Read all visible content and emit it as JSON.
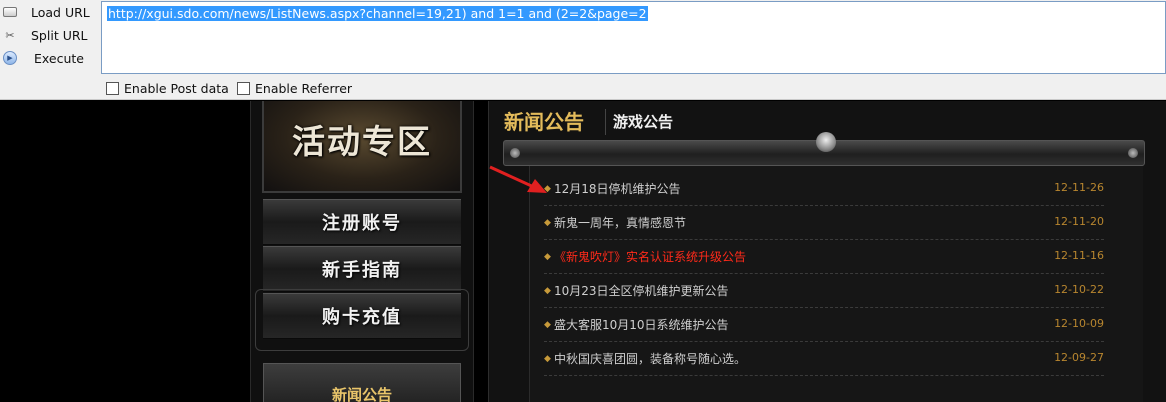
{
  "toolbar": {
    "load_url": "Load URL",
    "split_url": "Split URL",
    "execute": "Execute",
    "url_value": "http://xgui.sdo.com/news/ListNews.aspx?channel=19,21) and 1=1 and (2=2&page=2",
    "enable_post": "Enable Post data",
    "enable_referrer": "Enable Referrer"
  },
  "site": {
    "promo_title": "活动专区",
    "menu": [
      "注册账号",
      "新手指南",
      "购卡充值"
    ],
    "side_news": "新闻公告",
    "tab_news": "新闻公告",
    "tab_game": "游戏公告",
    "news": [
      {
        "title": "12月18日停机维护公告",
        "date": "12-11-26",
        "hot": false
      },
      {
        "title": "新鬼一周年，真情感恩节",
        "date": "12-11-20",
        "hot": false
      },
      {
        "title": "《新鬼吹灯》实名认证系统升级公告",
        "date": "12-11-16",
        "hot": true
      },
      {
        "title": "10月23日全区停机维护更新公告",
        "date": "12-10-22",
        "hot": false
      },
      {
        "title": "盛大客服10月10日系统维护公告",
        "date": "12-10-09",
        "hot": false
      },
      {
        "title": "中秋国庆喜团圆，装备称号随心选。",
        "date": "12-09-27",
        "hot": false
      }
    ]
  },
  "colors": {
    "accent_gold": "#e3bb5b",
    "date_gold": "#b8862f",
    "hot_red": "#ff2a1a",
    "selection_blue": "#3399ff",
    "arrow_red": "#e02020"
  },
  "icons": {
    "load_url": "load-url-icon",
    "split_url": "scissors-icon",
    "execute": "play-icon"
  }
}
